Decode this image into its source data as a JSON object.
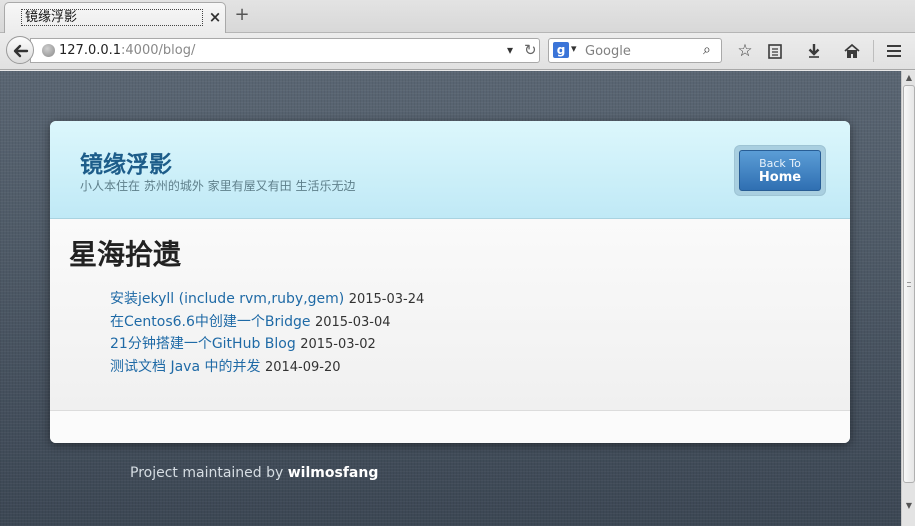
{
  "tab": {
    "title": "镜缘浮影",
    "close": "✕",
    "new_tab": "+"
  },
  "nav": {
    "url_host": "127.0.0.1",
    "url_rest": ":4000/blog/",
    "search_placeholder": "Google",
    "search_engine_letter": "g"
  },
  "site": {
    "title": "镜缘浮影",
    "subtitle": "小人本住在 苏州的城外 家里有屋又有田 生活乐无边",
    "home_button": {
      "small": "Back To",
      "big": "Home"
    }
  },
  "page": {
    "heading": "星海拾遗",
    "posts": [
      {
        "title": "安装jekyll (include rvm,ruby,gem)",
        "date": "2015-03-24"
      },
      {
        "title": "在Centos6.6中创建一个Bridge",
        "date": "2015-03-04"
      },
      {
        "title": "21分钟搭建一个GitHub Blog",
        "date": "2015-03-02"
      },
      {
        "title": "测试文档 Java 中的并发",
        "date": "2014-09-20"
      }
    ]
  },
  "footer": {
    "prefix": "Project maintained by",
    "author": "wilmosfang"
  },
  "colors": {
    "link": "#1f6aa6",
    "title": "#1d5d8a",
    "background": "#46525f"
  }
}
